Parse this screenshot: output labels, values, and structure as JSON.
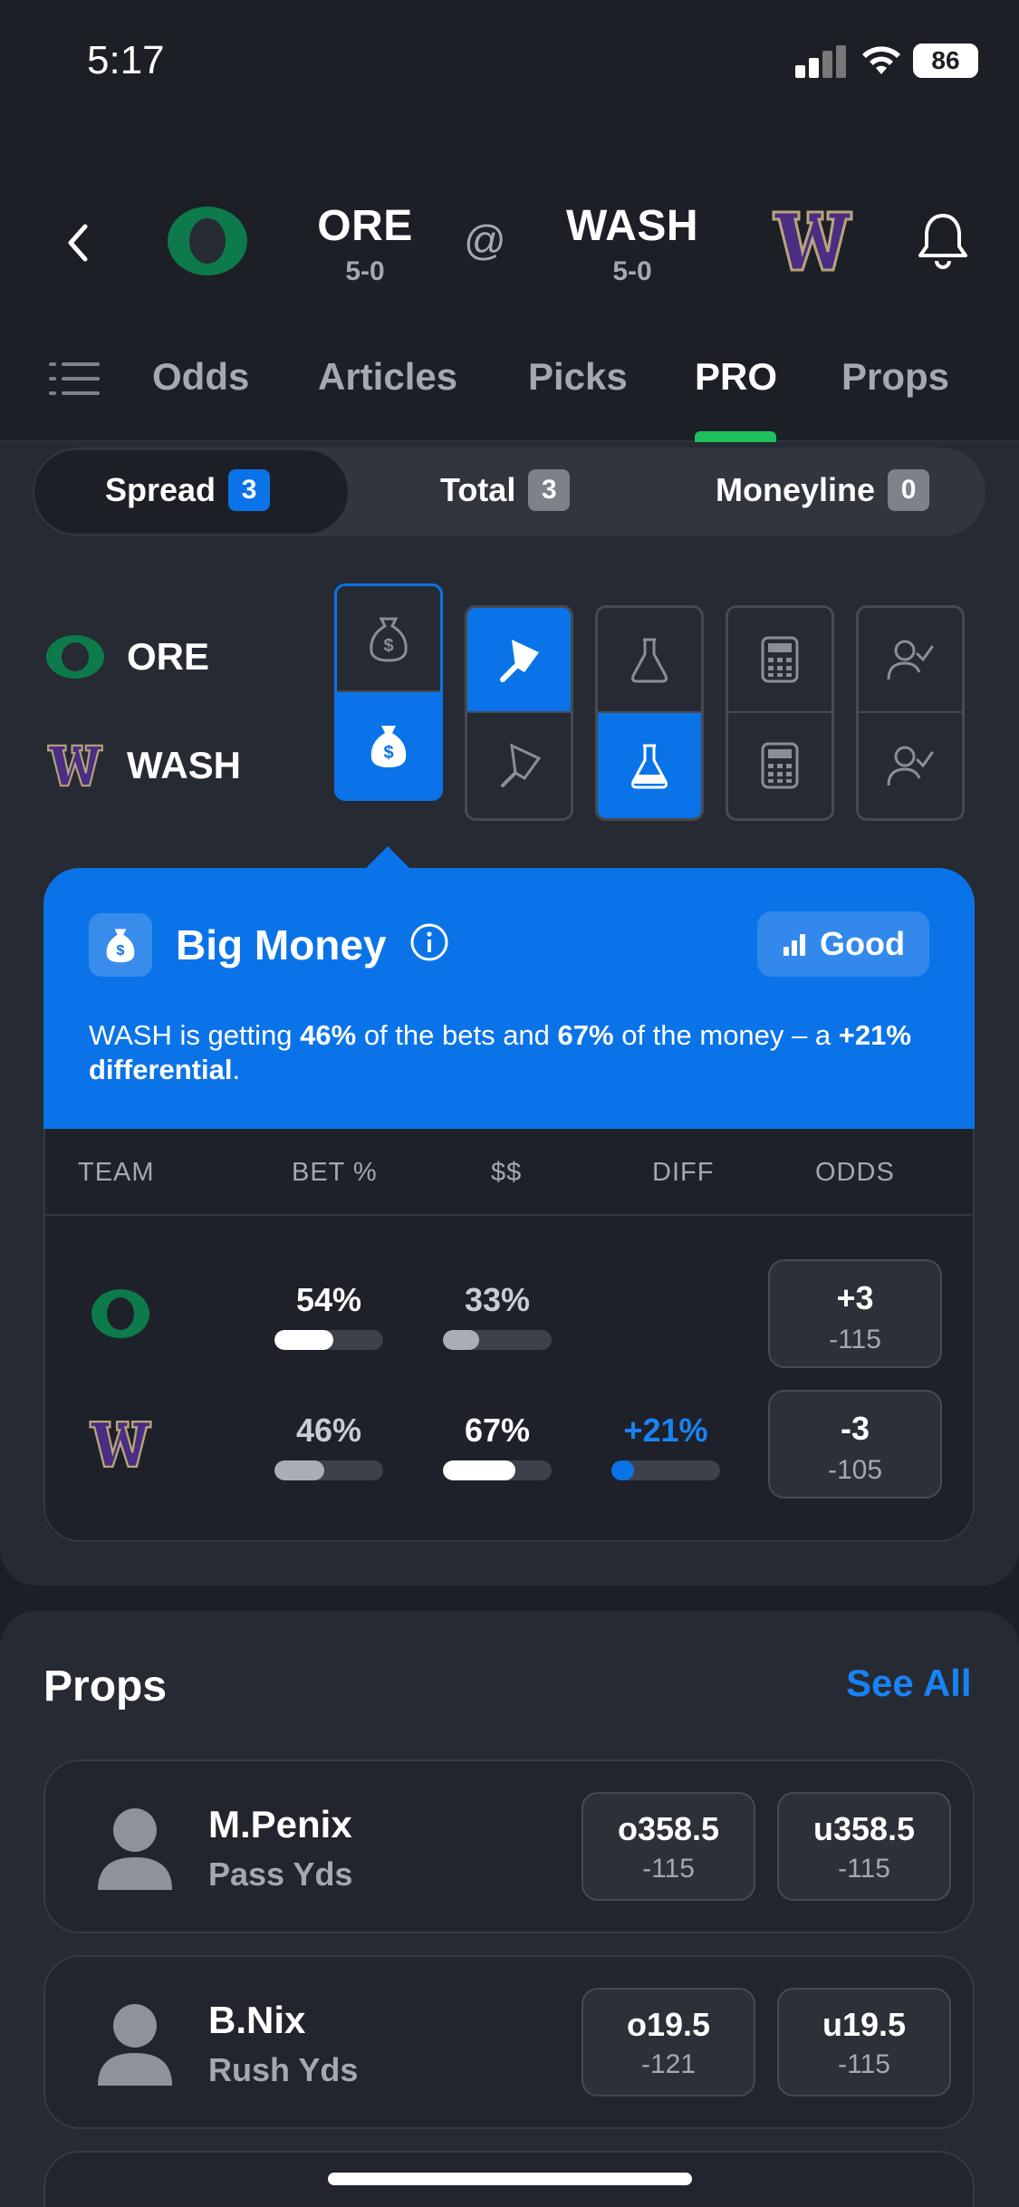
{
  "status_bar": {
    "time": "5:17",
    "battery": "86"
  },
  "matchup": {
    "away": {
      "abbr": "ORE",
      "record": "5-0"
    },
    "at": "@",
    "home": {
      "abbr": "WASH",
      "record": "5-0"
    }
  },
  "tabs": [
    {
      "label": "Odds",
      "active": false
    },
    {
      "label": "Articles",
      "active": false
    },
    {
      "label": "Picks",
      "active": false
    },
    {
      "label": "PRO",
      "active": true
    },
    {
      "label": "Props",
      "active": false
    }
  ],
  "market_tabs": [
    {
      "label": "Spread",
      "count": "3",
      "active": true
    },
    {
      "label": "Total",
      "count": "3",
      "active": false
    },
    {
      "label": "Moneyline",
      "count": "0",
      "active": false
    }
  ],
  "pro_indicators": {
    "teams": [
      "ORE",
      "WASH"
    ],
    "icons": [
      "money-bag-icon",
      "cleaver-icon",
      "flask-icon",
      "calculator-icon",
      "expert-icon"
    ]
  },
  "big_money": {
    "title": "Big Money",
    "rating": "Good",
    "desc_1": "WASH is getting ",
    "desc_bold_1": "46%",
    "desc_2": " of the bets and ",
    "desc_bold_2": "67%",
    "desc_3": " of the money – a ",
    "desc_bold_3": "+21% differential",
    "desc_4": ".",
    "headers": [
      "TEAM",
      "BET %",
      "$$",
      "DIFF",
      "ODDS"
    ],
    "rows": [
      {
        "bet_pct": "54%",
        "bet_fill": 0.54,
        "money_pct": "33%",
        "money_fill": 0.33,
        "diff": "",
        "diff_fill": 0,
        "odds_main": "+3",
        "odds_sub": "-115"
      },
      {
        "bet_pct": "46%",
        "bet_fill": 0.46,
        "money_pct": "67%",
        "money_fill": 0.67,
        "diff": "+21%",
        "diff_fill": 0.21,
        "odds_main": "-3",
        "odds_sub": "-105"
      }
    ]
  },
  "props": {
    "title": "Props",
    "see_all": "See All",
    "items": [
      {
        "player": "M.Penix",
        "stat": "Pass Yds",
        "over": "o358.5",
        "over_odds": "-115",
        "under": "u358.5",
        "under_odds": "-115"
      },
      {
        "player": "B.Nix",
        "stat": "Rush Yds",
        "over": "o19.5",
        "over_odds": "-121",
        "under": "u19.5",
        "under_odds": "-115"
      }
    ]
  },
  "colors": {
    "accent": "#0b73e8",
    "oregon_green": "#0d7a4b",
    "wash_purple": "#4b2e83",
    "wash_gold": "#b7a57a",
    "active_tab": "#1fbf5d"
  }
}
